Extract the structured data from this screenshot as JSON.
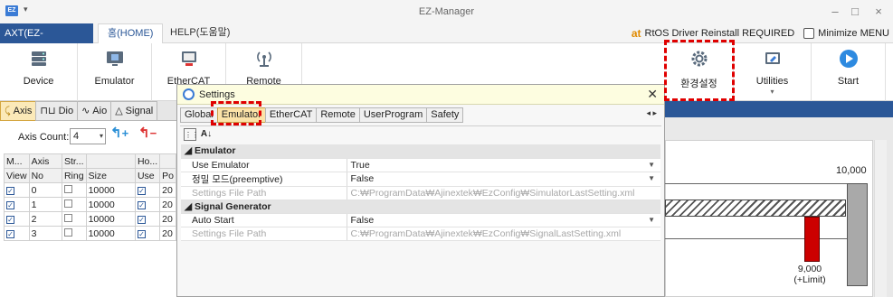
{
  "window": {
    "title": "EZ-Manager",
    "app_icon": "EZ",
    "minimize": "–",
    "maximize": "□",
    "close": "×"
  },
  "ribbon_tabs": {
    "app_menu": "AXT(EZ-MANAGER)",
    "home": "홈(HOME)",
    "help": "HELP(도움말)"
  },
  "status": {
    "brand": "at",
    "message": "RtOS Driver Reinstall REQUIRED",
    "minimize_menu": "Minimize MENU"
  },
  "ribbon": {
    "device": "Device",
    "emulator": "Emulator",
    "ethercat": "EtherCAT",
    "remote": "Remote",
    "settings": "환경설정",
    "utilities": "Utilities",
    "start": "Start",
    "utilities_caret": "▾"
  },
  "left_tabs": [
    "Axis",
    "Dio",
    "Aio",
    "Signal"
  ],
  "axis_count": {
    "label": "Axis Count:",
    "value": "4"
  },
  "axis_table": {
    "header1": [
      "M...",
      "Axis",
      "Str...",
      "",
      "Ho..."
    ],
    "header2": [
      "View",
      "No",
      "Ring",
      "Size",
      "Use",
      "Po"
    ],
    "rows": [
      {
        "no": "0",
        "size": "10000",
        "po": "20"
      },
      {
        "no": "1",
        "size": "10000",
        "po": "20"
      },
      {
        "no": "2",
        "size": "10000",
        "po": "20"
      },
      {
        "no": "3",
        "size": "10000",
        "po": "20"
      }
    ]
  },
  "dialog": {
    "title": "Settings",
    "close": "✕",
    "tabs": [
      "Global",
      "Emulator",
      "EtherCAT",
      "Remote",
      "UserProgram",
      "Safety"
    ],
    "tab_nav": "◂ ▸",
    "sort_icon": "A↓",
    "categories": [
      {
        "name": "Emulator",
        "props": [
          {
            "name": "Use Emulator",
            "value": "True",
            "dropdown": true,
            "disabled": false
          },
          {
            "name": "정밀 모드(preemptive)",
            "value": "False",
            "dropdown": true,
            "disabled": false
          },
          {
            "name": "Settings File Path",
            "value": "C:₩ProgramData₩Ajinextek₩EzConfig₩SimulatorLastSetting.xml",
            "dropdown": false,
            "disabled": true
          }
        ]
      },
      {
        "name": "Signal Generator",
        "props": [
          {
            "name": "Auto Start",
            "value": "False",
            "dropdown": true,
            "disabled": false
          },
          {
            "name": "Settings File Path",
            "value": "C:₩ProgramData₩Ajinextek₩EzConfig₩SignalLastSetting.xml",
            "dropdown": false,
            "disabled": true
          }
        ]
      }
    ]
  },
  "chart": {
    "top_label": "10,000",
    "bottom_label_value": "9,000",
    "bottom_label_note": "(+Limit)"
  },
  "colors": {
    "accent": "#2b5797",
    "highlight": "#e00000",
    "active_tab": "#fbe3a8"
  }
}
